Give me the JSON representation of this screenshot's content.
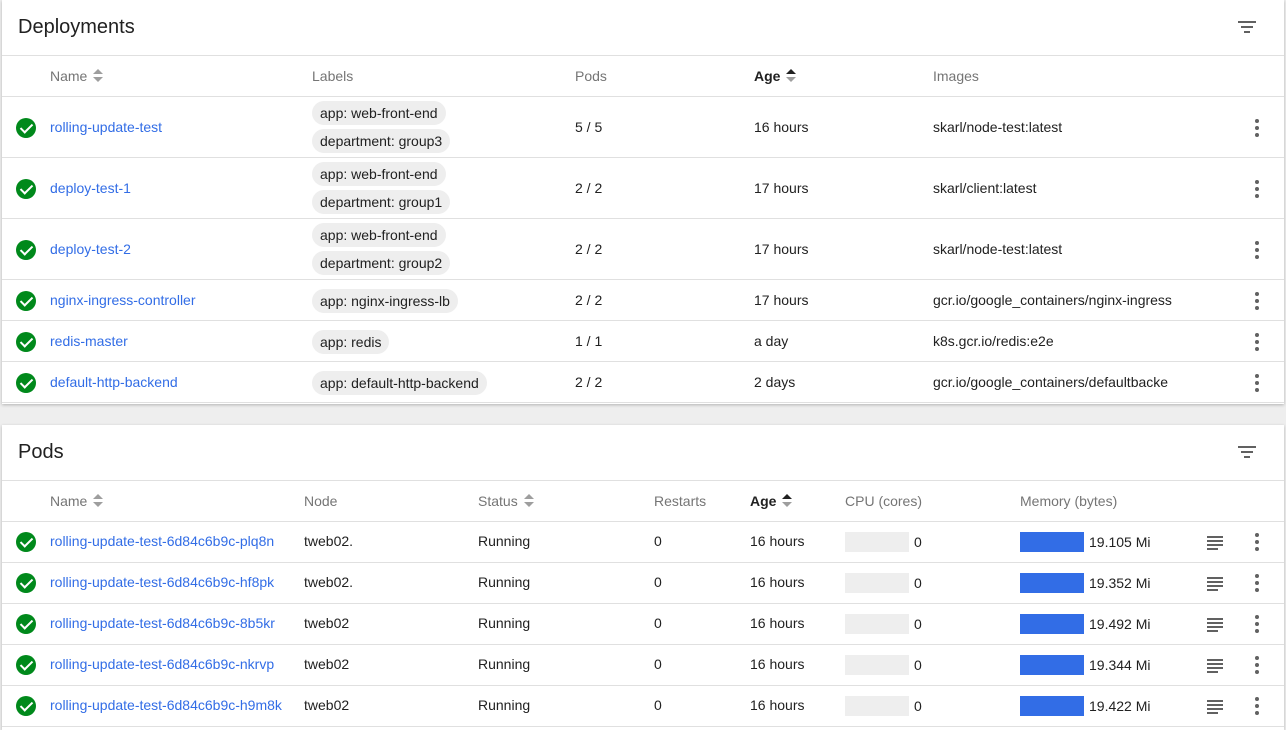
{
  "deployments": {
    "title": "Deployments",
    "headers": {
      "name": "Name",
      "labels": "Labels",
      "pods": "Pods",
      "age": "Age",
      "images": "Images"
    },
    "rows": [
      {
        "name": "rolling-update-test",
        "labels": [
          "app: web-front-end",
          "department: group3"
        ],
        "pods": "5 / 5",
        "age": "16 hours",
        "image": "skarl/node-test:latest"
      },
      {
        "name": "deploy-test-1",
        "labels": [
          "app: web-front-end",
          "department: group1"
        ],
        "pods": "2 / 2",
        "age": "17 hours",
        "image": "skarl/client:latest"
      },
      {
        "name": "deploy-test-2",
        "labels": [
          "app: web-front-end",
          "department: group2"
        ],
        "pods": "2 / 2",
        "age": "17 hours",
        "image": "skarl/node-test:latest"
      },
      {
        "name": "nginx-ingress-controller",
        "labels": [
          "app: nginx-ingress-lb"
        ],
        "pods": "2 / 2",
        "age": "17 hours",
        "image": "gcr.io/google_containers/nginx-ingress"
      },
      {
        "name": "redis-master",
        "labels": [
          "app: redis"
        ],
        "pods": "1 / 1",
        "age": "a day",
        "image": "k8s.gcr.io/redis:e2e"
      },
      {
        "name": "default-http-backend",
        "labels": [
          "app: default-http-backend"
        ],
        "pods": "2 / 2",
        "age": "2 days",
        "image": "gcr.io/google_containers/defaultbacke"
      }
    ]
  },
  "pods": {
    "title": "Pods",
    "headers": {
      "name": "Name",
      "node": "Node",
      "status": "Status",
      "restarts": "Restarts",
      "age": "Age",
      "cpu": "CPU (cores)",
      "memory": "Memory (bytes)"
    },
    "rows": [
      {
        "name": "rolling-update-test-6d84c6b9c-plq8n",
        "node": "tweb02.",
        "status": "Running",
        "restarts": "0",
        "age": "16 hours",
        "cpu": "0",
        "cpu_fraction": 0,
        "memory": "19.105 Mi",
        "memory_fraction": 1
      },
      {
        "name": "rolling-update-test-6d84c6b9c-hf8pk",
        "node": "tweb02.",
        "status": "Running",
        "restarts": "0",
        "age": "16 hours",
        "cpu": "0",
        "cpu_fraction": 0,
        "memory": "19.352 Mi",
        "memory_fraction": 1
      },
      {
        "name": "rolling-update-test-6d84c6b9c-8b5kr",
        "node": "tweb02",
        "status": "Running",
        "restarts": "0",
        "age": "16 hours",
        "cpu": "0",
        "cpu_fraction": 0,
        "memory": "19.492 Mi",
        "memory_fraction": 1
      },
      {
        "name": "rolling-update-test-6d84c6b9c-nkrvp",
        "node": "tweb02",
        "status": "Running",
        "restarts": "0",
        "age": "16 hours",
        "cpu": "0",
        "cpu_fraction": 0,
        "memory": "19.344 Mi",
        "memory_fraction": 1
      },
      {
        "name": "rolling-update-test-6d84c6b9c-h9m8k",
        "node": "tweb02",
        "status": "Running",
        "restarts": "0",
        "age": "16 hours",
        "cpu": "0",
        "cpu_fraction": 0,
        "memory": "19.422 Mi",
        "memory_fraction": 1
      }
    ]
  },
  "icons": {
    "status": "check-circle-icon",
    "filter": "filter-icon",
    "more": "more-vert-icon",
    "logs": "logs-icon"
  },
  "colors": {
    "link": "#326de6",
    "success": "#00891b",
    "memory_bar": "#326de6",
    "bar_track": "#eeeeee"
  }
}
